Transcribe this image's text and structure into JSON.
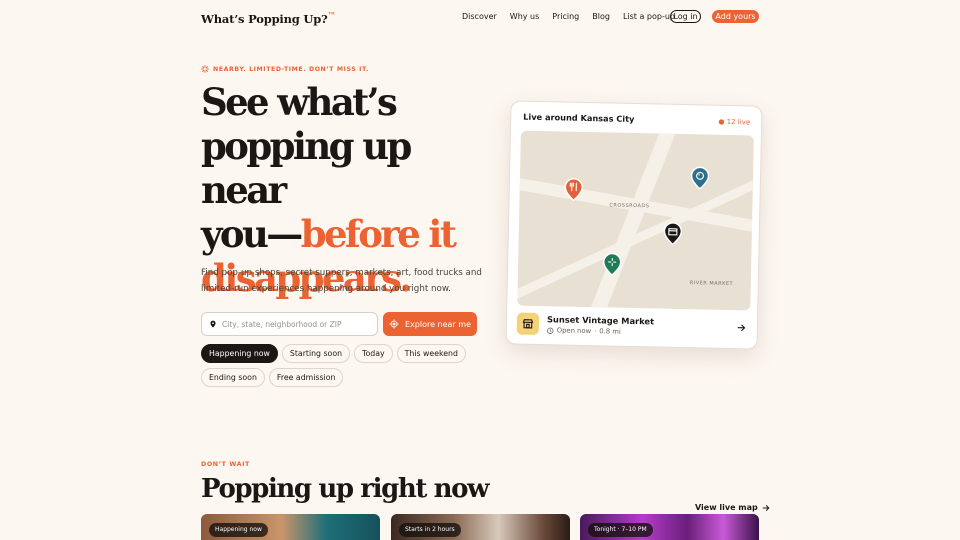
{
  "brand": {
    "name": "What’s Popping Up?",
    "mark": "™"
  },
  "nav": {
    "links": [
      "Discover",
      "Why us",
      "Pricing",
      "Blog",
      "List a pop-up"
    ],
    "login": "Log in",
    "add": "Add yours"
  },
  "hero": {
    "eyebrow": "NEARBY. LIMITED-TIME. DON’T MISS IT.",
    "headline_1": "See what’s",
    "headline_2": "popping up near",
    "headline_3a": "you—",
    "headline_3b": "before it",
    "headline_4": "disappears.",
    "subtext": "Find pop-up shops, secret suppers, markets, art, food trucks and limited-run experiences happening around you right now.",
    "search_placeholder": "City, state, neighborhood or ZIP",
    "explore": "Explore near me",
    "chips": [
      "Happening now",
      "Starting soon",
      "Today",
      "This weekend",
      "Ending soon",
      "Free admission"
    ]
  },
  "map_card": {
    "title": "Live around Kansas City",
    "live": "● 12 live",
    "labels": {
      "crossroads": "CROSSROADS",
      "river_market": "RIVER MARKET"
    },
    "place": {
      "name": "Sunset Vintage Market",
      "status": "Open now",
      "distance": "0.8 mi"
    }
  },
  "section": {
    "eyebrow": "DON’T WAIT",
    "title": "Popping up right now",
    "view_map": "View live map"
  },
  "tiles": [
    {
      "tag": "Happening now"
    },
    {
      "tag": "Starts in 2 hours"
    },
    {
      "tag": "Tonight · 7–10 PM"
    }
  ],
  "colors": {
    "accent": "#ec6333",
    "background": "#fdf7f1",
    "ink": "#1c1714"
  }
}
